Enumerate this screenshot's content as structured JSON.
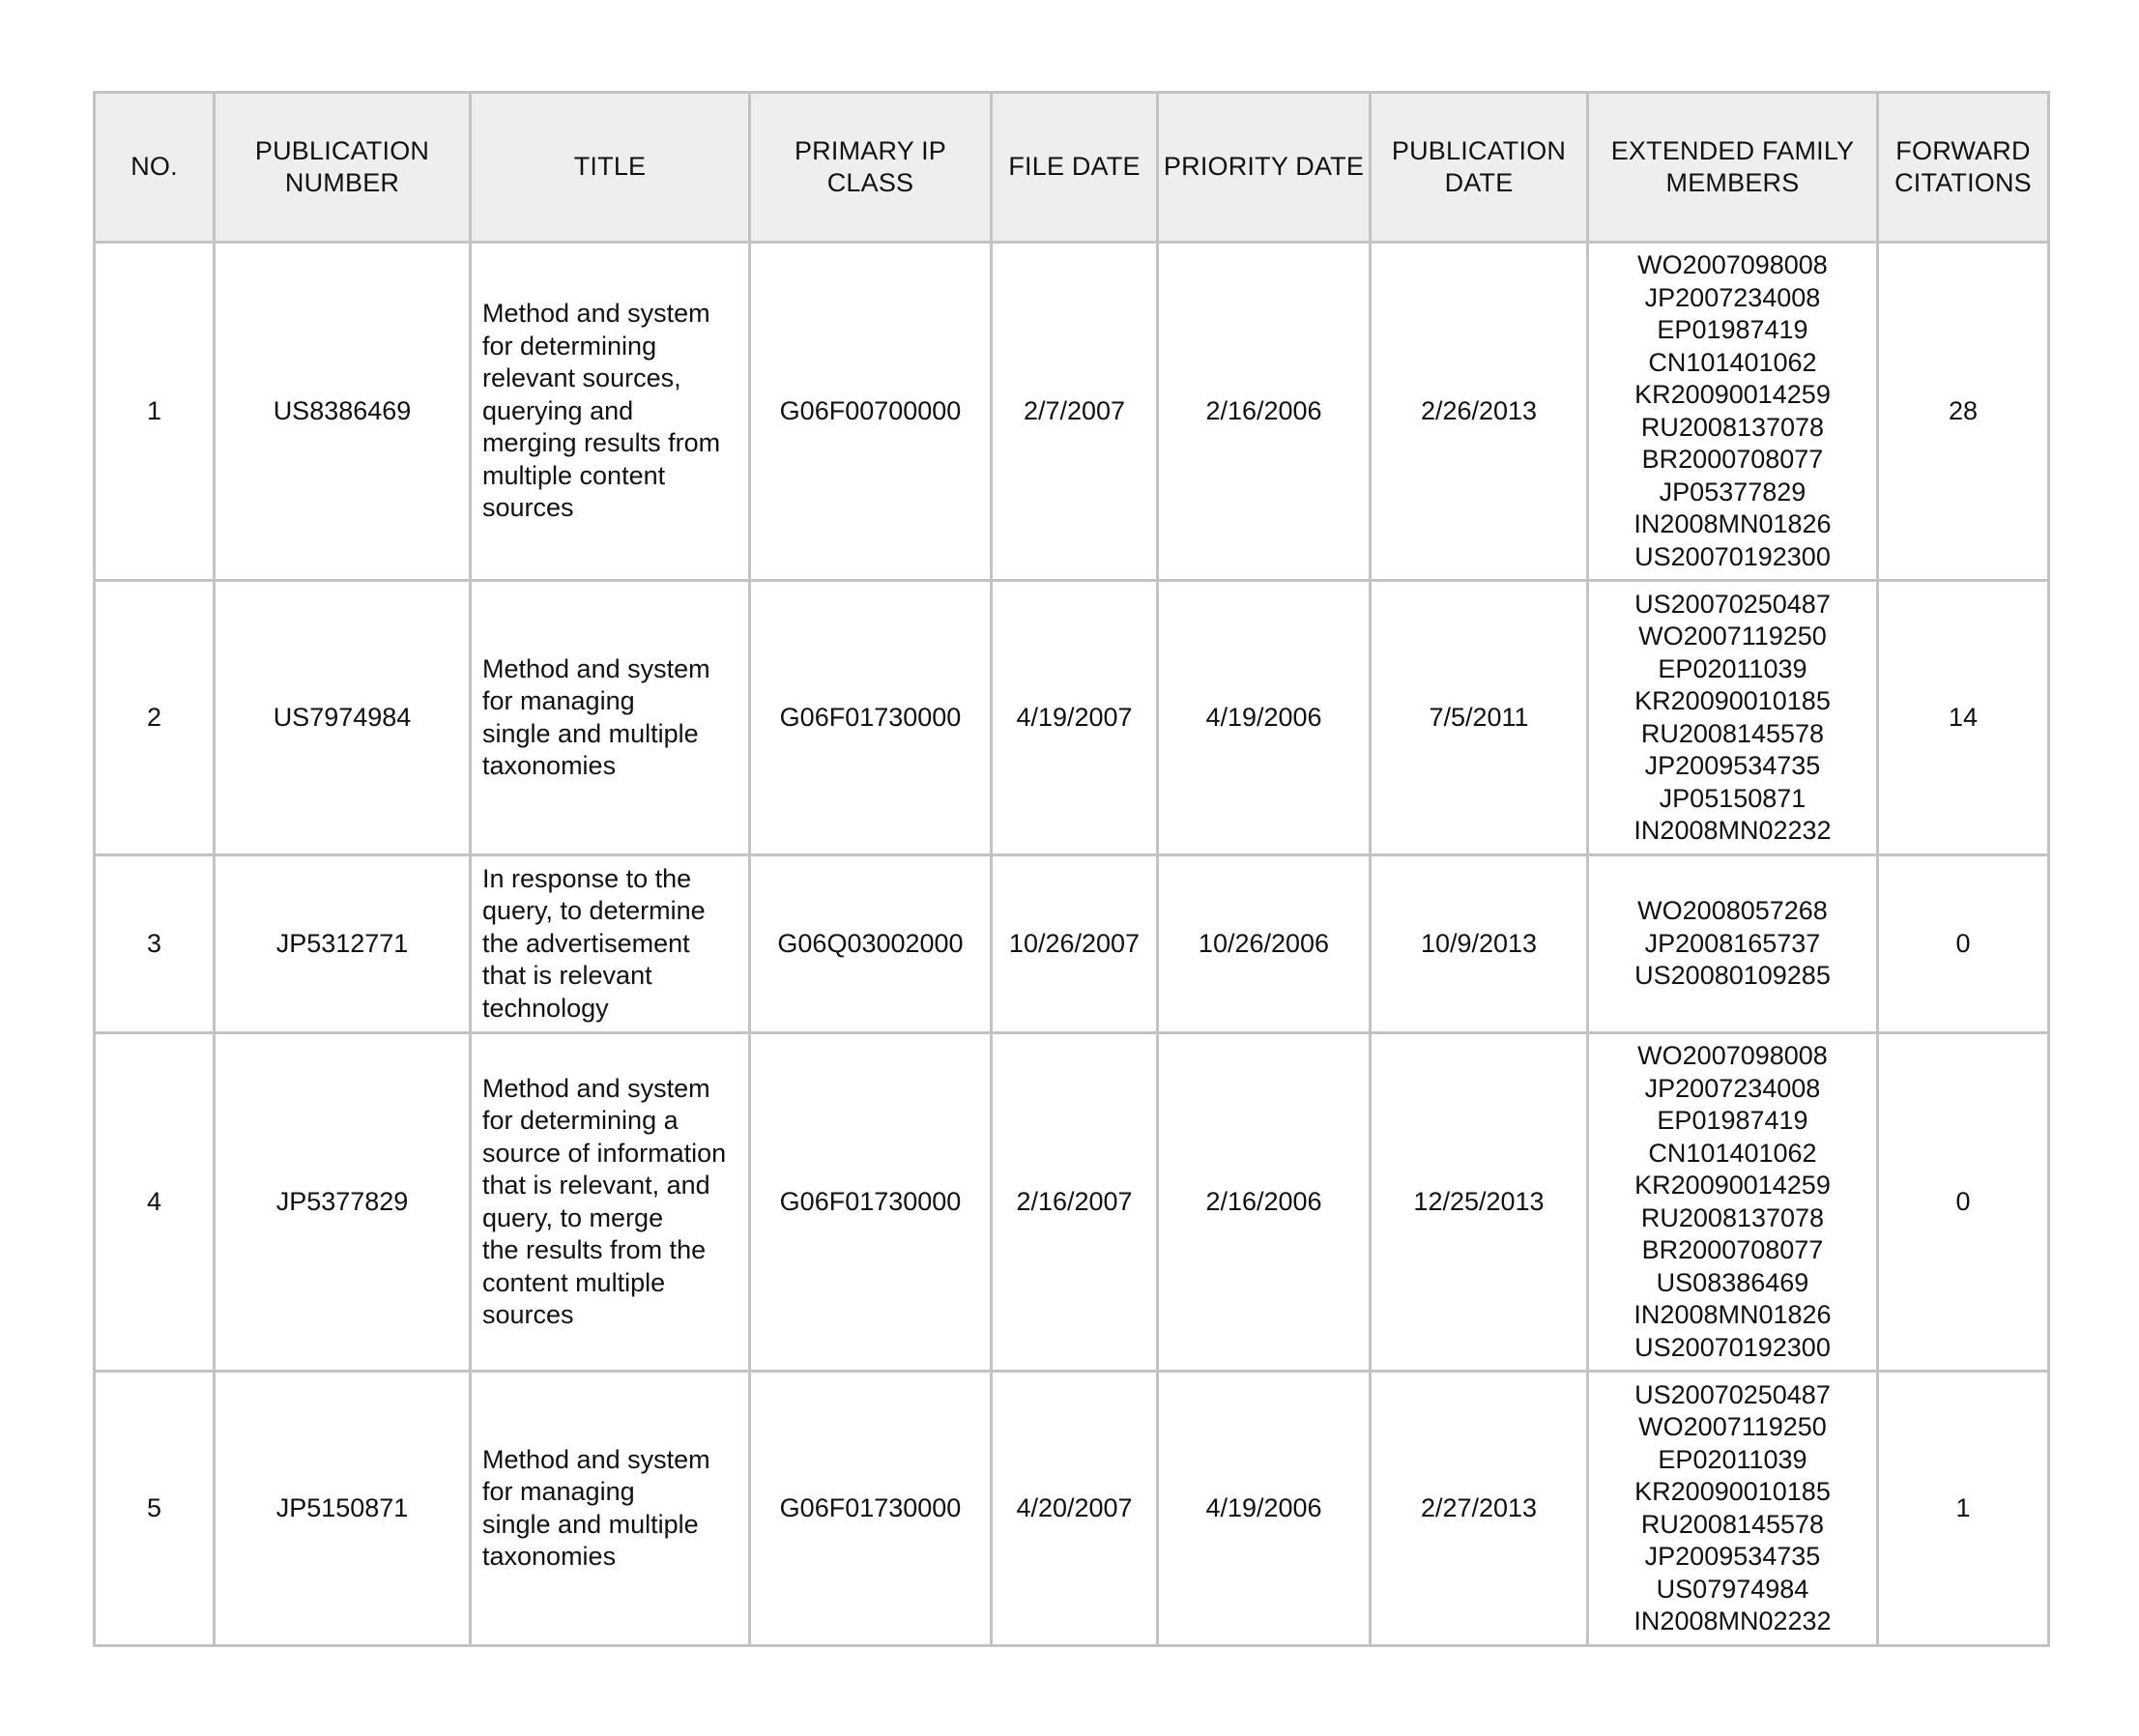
{
  "table": {
    "headers": [
      "NO.",
      "PUBLICATION\nNUMBER",
      "TITLE",
      "PRIMARY IP\nCLASS",
      "FILE DATE",
      "PRIORITY DATE",
      "PUBLICATION\nDATE",
      "EXTENDED FAMILY\nMEMBERS",
      "FORWARD\nCITATIONS"
    ],
    "rows": [
      {
        "no": "1",
        "publication_number": "US8386469",
        "title_lines": [
          "Method and system",
          "for determining",
          "relevant sources,",
          "querying and",
          "merging results from",
          "multiple content",
          "sources"
        ],
        "primary_ip_class": "G06F00700000",
        "file_date": "2/7/2007",
        "priority_date": "2/16/2006",
        "publication_date": "2/26/2013",
        "extended_family_members": [
          "WO2007098008",
          "JP2007234008",
          "EP01987419",
          "CN101401062",
          "KR20090014259",
          "RU2008137078",
          "BR2000708077",
          "JP05377829",
          "IN2008MN01826",
          "US20070192300"
        ],
        "forward_citations": "28"
      },
      {
        "no": "2",
        "publication_number": "US7974984",
        "title_lines": [
          "Method and system",
          "for managing",
          "single and multiple",
          "taxonomies"
        ],
        "primary_ip_class": "G06F01730000",
        "file_date": "4/19/2007",
        "priority_date": "4/19/2006",
        "publication_date": "7/5/2011",
        "extended_family_members": [
          "US20070250487",
          "WO2007119250",
          "EP02011039",
          "KR20090010185",
          "RU2008145578",
          "JP2009534735",
          "JP05150871",
          "IN2008MN02232"
        ],
        "forward_citations": "14"
      },
      {
        "no": "3",
        "publication_number": "JP5312771",
        "title_lines": [
          "In response to the",
          "query, to determine",
          "the advertisement",
          "that is relevant",
          "technology"
        ],
        "primary_ip_class": "G06Q03002000",
        "file_date": "10/26/2007",
        "priority_date": "10/26/2006",
        "publication_date": "10/9/2013",
        "extended_family_members": [
          "WO2008057268",
          "JP2008165737",
          "US20080109285"
        ],
        "forward_citations": "0"
      },
      {
        "no": "4",
        "publication_number": "JP5377829",
        "title_lines": [
          "Method and system",
          "for determining a",
          "source of information",
          "that is relevant, and",
          "query, to merge",
          "the results from the",
          "content multiple",
          "sources"
        ],
        "primary_ip_class": "G06F01730000",
        "file_date": "2/16/2007",
        "priority_date": "2/16/2006",
        "publication_date": "12/25/2013",
        "extended_family_members": [
          "WO2007098008",
          "JP2007234008",
          "EP01987419",
          "CN101401062",
          "KR20090014259",
          "RU2008137078",
          "BR2000708077",
          "US08386469",
          "IN2008MN01826",
          "US20070192300"
        ],
        "forward_citations": "0"
      },
      {
        "no": "5",
        "publication_number": "JP5150871",
        "title_lines": [
          "Method and system",
          "for managing",
          "single and multiple",
          "taxonomies"
        ],
        "primary_ip_class": "G06F01730000",
        "file_date": "4/20/2007",
        "priority_date": "4/19/2006",
        "publication_date": "2/27/2013",
        "extended_family_members": [
          "US20070250487",
          "WO2007119250",
          "EP02011039",
          "KR20090010185",
          "RU2008145578",
          "JP2009534735",
          "US07974984",
          "IN2008MN02232"
        ],
        "forward_citations": "1"
      }
    ]
  },
  "colors": {
    "header_background": "#eeeeee",
    "grid_lines": "#c3c3c3",
    "text": "#111111",
    "page_background": "#ffffff"
  }
}
